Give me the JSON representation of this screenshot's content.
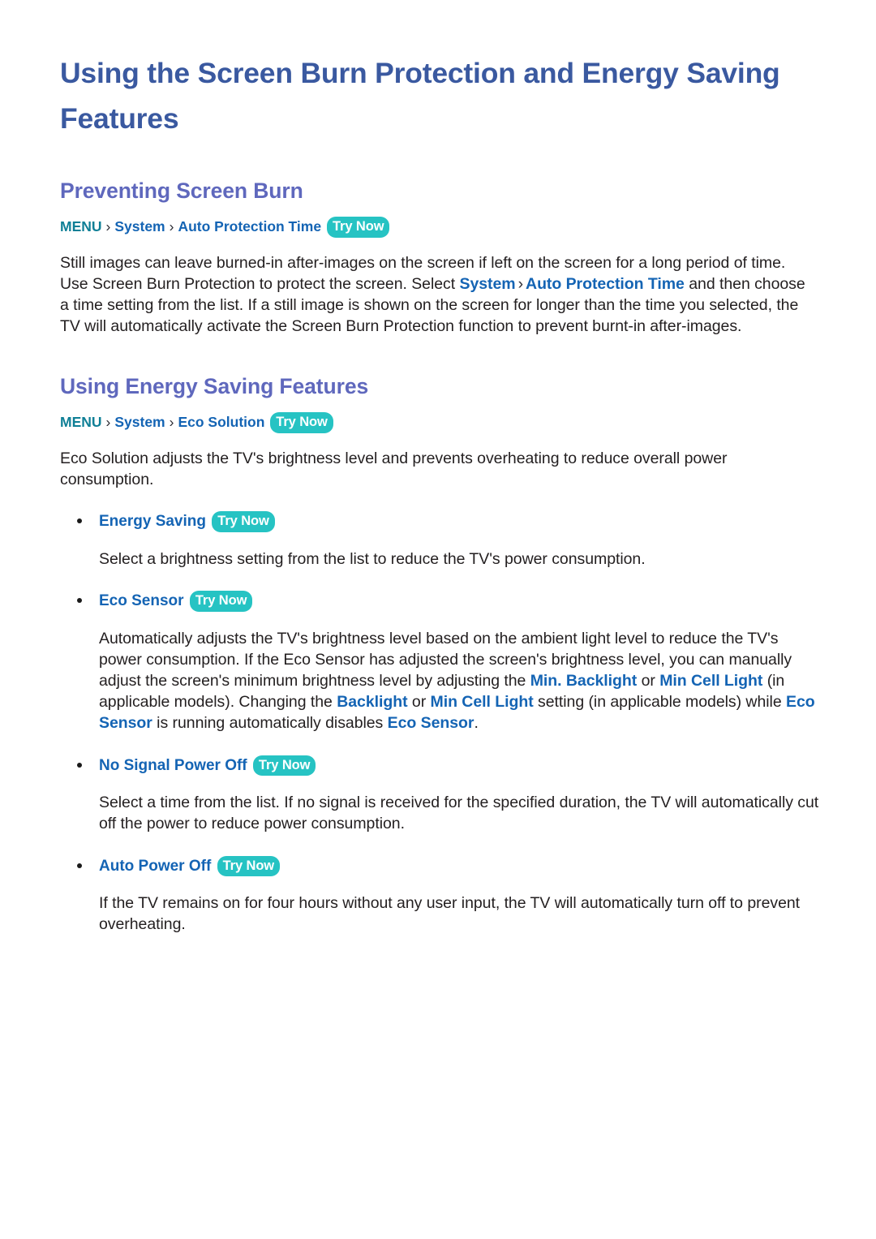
{
  "document": {
    "title": "Using the Screen Burn Protection and Energy Saving Features",
    "colors": {
      "title": "#3a59a0",
      "section_heading": "#5f68bd",
      "breadcrumb_menu": "#0f7f96",
      "link_blue": "#1464b4",
      "badge_teal": "#26c3c3",
      "body_text": "#231f20",
      "background": "#ffffff"
    }
  },
  "sections": [
    {
      "heading": "Preventing Screen Burn",
      "breadcrumb": {
        "menu_label": "MENU",
        "separator": "›",
        "items": [
          "System",
          "Auto Protection Time"
        ],
        "badge": "Try Now"
      },
      "paragraph": {
        "part1": "Still images can leave burned-in after-images on the screen if left on the screen for a long period of time. Use Screen Burn Protection to protect the screen. Select ",
        "link1": "System",
        "sep1": "›",
        "link2": "Auto Protection Time",
        "part2": " and then choose a time setting from the list. If a still image is shown on the screen for longer than the time you selected, the TV will automatically activate the Screen Burn Protection function to prevent burnt-in after-images."
      }
    },
    {
      "heading": "Using Energy Saving Features",
      "breadcrumb": {
        "menu_label": "MENU",
        "separator": "›",
        "items": [
          "System",
          "Eco Solution"
        ],
        "badge": "Try Now"
      },
      "intro": "Eco Solution adjusts the TV's brightness level and prevents overheating to reduce overall power consumption.",
      "bullets": [
        {
          "title": "Energy Saving",
          "badge": "Try Now",
          "body": {
            "text": "Select a brightness setting from the list to reduce the TV's power consumption."
          }
        },
        {
          "title": "Eco Sensor",
          "badge": "Try Now",
          "body": {
            "p1": "Automatically adjusts the TV's brightness level based on the ambient light level to reduce the TV's power consumption. If the Eco Sensor has adjusted the screen's brightness level, you can manually adjust the screen's minimum brightness level by adjusting the ",
            "t1": "Min. Backlight",
            "p2": " or ",
            "t2": "Min Cell Light",
            "p3": " (in applicable models). Changing the ",
            "t3": "Backlight",
            "p4": " or ",
            "t4": "Min Cell Light",
            "p5": " setting (in applicable models) while ",
            "t5": "Eco Sensor",
            "p6": " is running automatically disables ",
            "t6": "Eco Sensor",
            "p7": "."
          }
        },
        {
          "title": "No Signal Power Off",
          "badge": "Try Now",
          "body": {
            "text": "Select a time from the list. If no signal is received for the specified duration, the TV will automatically cut off the power to reduce power consumption."
          }
        },
        {
          "title": "Auto Power Off",
          "badge": "Try Now",
          "body": {
            "text": "If the TV remains on for four hours without any user input, the TV will automatically turn off to prevent overheating."
          }
        }
      ]
    }
  ]
}
